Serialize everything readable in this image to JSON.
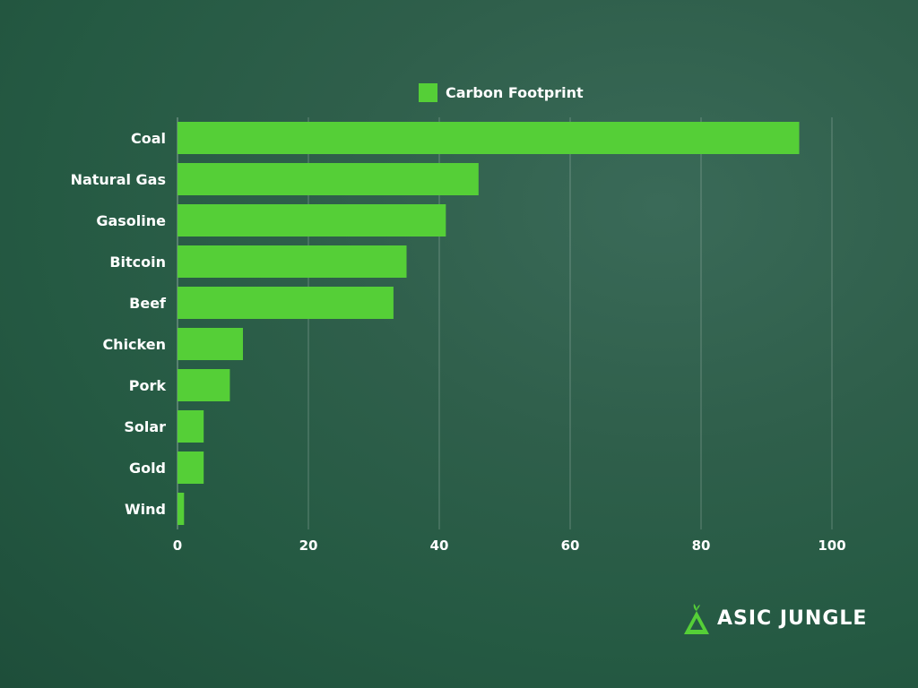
{
  "chart_data": {
    "type": "bar",
    "orientation": "horizontal",
    "title": "",
    "xlabel": "",
    "ylabel": "",
    "categories": [
      "Coal",
      "Natural Gas",
      "Gasoline",
      "Bitcoin",
      "Beef",
      "Chicken",
      "Pork",
      "Solar",
      "Gold",
      "Wind"
    ],
    "series": [
      {
        "name": "Carbon Footprint",
        "values": [
          95,
          46,
          41,
          35,
          33,
          10,
          8,
          4,
          4,
          1
        ],
        "color": "#55cf37"
      }
    ],
    "xlim": [
      0,
      100
    ],
    "xticks": [
      0,
      20,
      40,
      60,
      80,
      100
    ],
    "grid": true,
    "legend": "top-center"
  },
  "branding": {
    "logo_text": "ASIC JUNGLE",
    "accent": "#55cf37"
  }
}
